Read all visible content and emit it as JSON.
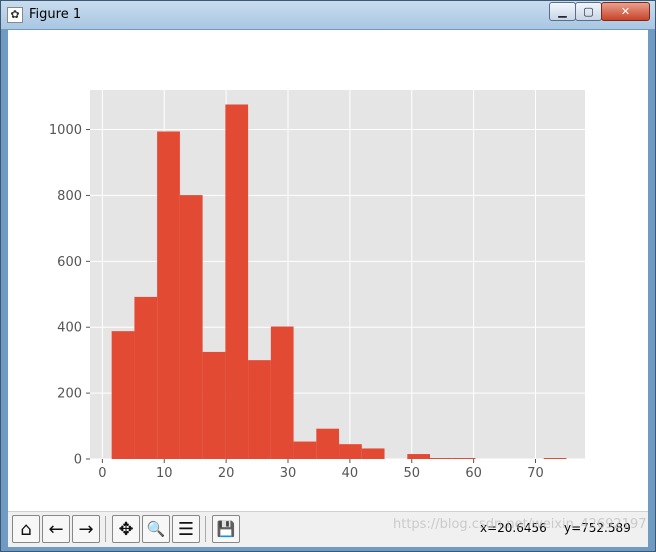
{
  "window": {
    "title": "Figure 1",
    "minimize_label": "▁",
    "maximize_label": "▢",
    "close_label": "✕"
  },
  "toolbar": {
    "buttons": [
      {
        "name": "home-button",
        "icon": "home-icon",
        "glyph": "⌂"
      },
      {
        "name": "back-button",
        "icon": "arrow-left-icon",
        "glyph": "←"
      },
      {
        "name": "forward-button",
        "icon": "arrow-right-icon",
        "glyph": "→"
      },
      {
        "name": "pan-button",
        "icon": "move-icon",
        "glyph": "✥"
      },
      {
        "name": "zoom-button",
        "icon": "magnifier-icon",
        "glyph": "🔍"
      },
      {
        "name": "configure-subplots-button",
        "icon": "sliders-icon",
        "glyph": "☰"
      },
      {
        "name": "save-button",
        "icon": "floppy-disk-icon",
        "glyph": "💾"
      }
    ],
    "x_readout": "x=20.6456",
    "y_readout": "y=752.589"
  },
  "watermark": "https://blog.csdn.net/weixin_42692197",
  "chart_data": {
    "type": "bar",
    "title": "",
    "xlabel": "",
    "ylabel": "",
    "xlim": [
      -2,
      78
    ],
    "ylim": [
      0,
      1120
    ],
    "xticks": [
      0,
      10,
      20,
      30,
      40,
      50,
      60,
      70
    ],
    "yticks": [
      0,
      200,
      400,
      600,
      800,
      1000
    ],
    "bin_edges": [
      1.5,
      5.18,
      8.85,
      12.53,
      16.2,
      19.88,
      23.55,
      27.23,
      30.9,
      34.58,
      38.25,
      41.93,
      45.6,
      49.28,
      52.95,
      56.63,
      60.3,
      63.98,
      67.65,
      71.33,
      75.0
    ],
    "values": [
      388,
      492,
      994,
      801,
      325,
      1076,
      300,
      402,
      53,
      92,
      45,
      32,
      0,
      15,
      3,
      3,
      0,
      0,
      0,
      3
    ],
    "bar_color": "#e24a33",
    "background_color": "#e5e5e5",
    "grid": true
  }
}
